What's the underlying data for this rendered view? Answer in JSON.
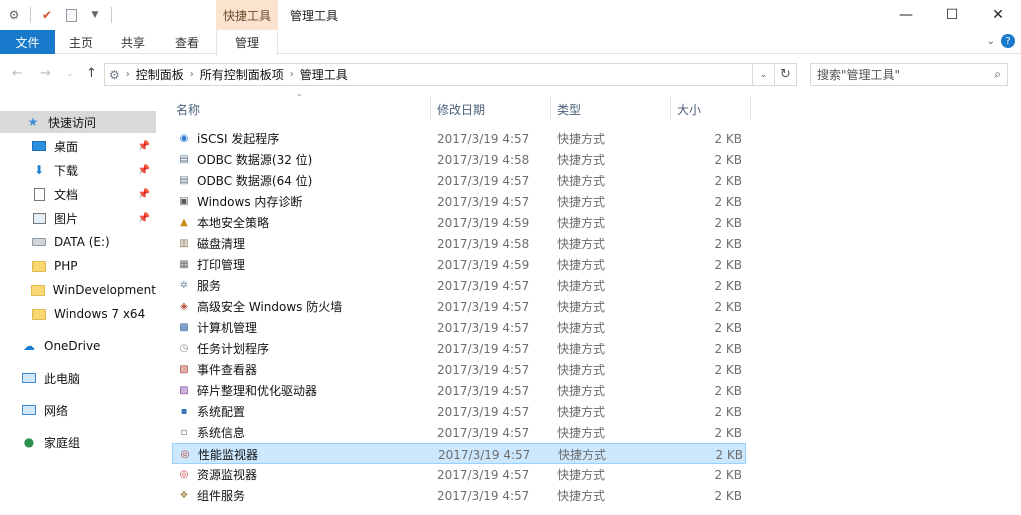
{
  "titlebar": {
    "context_tab_header": "快捷工具",
    "window_title": "管理工具",
    "minimize": "—",
    "maximize": "☐",
    "close": "✕"
  },
  "ribbon": {
    "tabs": {
      "file": "文件",
      "home": "主页",
      "share": "共享",
      "view": "查看",
      "manage": "管理"
    },
    "help": "?"
  },
  "address": {
    "crumbs": [
      "控制面板",
      "所有控制面板项",
      "管理工具"
    ],
    "search_placeholder": "搜索\"管理工具\""
  },
  "navpane": {
    "quick_access": "快速访问",
    "pinned": [
      {
        "label": "桌面",
        "icon": "desktop-icon"
      },
      {
        "label": "下载",
        "icon": "download-icon"
      },
      {
        "label": "文档",
        "icon": "document-icon"
      },
      {
        "label": "图片",
        "icon": "picture-icon"
      }
    ],
    "other": [
      {
        "label": "DATA (E:)",
        "icon": "drive-icon"
      },
      {
        "label": "PHP",
        "icon": "folder-icon"
      },
      {
        "label": "WinDevelopment",
        "icon": "folder-icon"
      },
      {
        "label": "Windows 7 x64",
        "icon": "folder-icon"
      }
    ],
    "onedrive": "OneDrive",
    "this_pc": "此电脑",
    "network": "网络",
    "homegroup": "家庭组"
  },
  "columns": {
    "name": "名称",
    "date": "修改日期",
    "type": "类型",
    "size": "大小"
  },
  "files": [
    {
      "name": "iSCSI 发起程序",
      "date": "2017/3/19 4:57",
      "type": "快捷方式",
      "size": "2 KB",
      "icon": "globe-icon",
      "color": "#2e7bcf"
    },
    {
      "name": "ODBC 数据源(32 位)",
      "date": "2017/3/19 4:58",
      "type": "快捷方式",
      "size": "2 KB",
      "icon": "database-icon",
      "color": "#5a6f84"
    },
    {
      "name": "ODBC 数据源(64 位)",
      "date": "2017/3/19 4:57",
      "type": "快捷方式",
      "size": "2 KB",
      "icon": "database-icon",
      "color": "#5a6f84"
    },
    {
      "name": "Windows 内存诊断",
      "date": "2017/3/19 4:57",
      "type": "快捷方式",
      "size": "2 KB",
      "icon": "memory-icon",
      "color": "#5b5b5b"
    },
    {
      "name": "本地安全策略",
      "date": "2017/3/19 4:59",
      "type": "快捷方式",
      "size": "2 KB",
      "icon": "security-icon",
      "color": "#c98a1a"
    },
    {
      "name": "磁盘清理",
      "date": "2017/3/19 4:58",
      "type": "快捷方式",
      "size": "2 KB",
      "icon": "disk-cleanup-icon",
      "color": "#8a7a5a"
    },
    {
      "name": "打印管理",
      "date": "2017/3/19 4:59",
      "type": "快捷方式",
      "size": "2 KB",
      "icon": "printer-icon",
      "color": "#6a6a6a"
    },
    {
      "name": "服务",
      "date": "2017/3/19 4:57",
      "type": "快捷方式",
      "size": "2 KB",
      "icon": "services-icon",
      "color": "#7a8fa5"
    },
    {
      "name": "高级安全 Windows 防火墙",
      "date": "2017/3/19 4:57",
      "type": "快捷方式",
      "size": "2 KB",
      "icon": "firewall-icon",
      "color": "#b5482e"
    },
    {
      "name": "计算机管理",
      "date": "2017/3/19 4:57",
      "type": "快捷方式",
      "size": "2 KB",
      "icon": "computer-management-icon",
      "color": "#3c6fa8"
    },
    {
      "name": "任务计划程序",
      "date": "2017/3/19 4:57",
      "type": "快捷方式",
      "size": "2 KB",
      "icon": "clock-icon",
      "color": "#8c8c8c"
    },
    {
      "name": "事件查看器",
      "date": "2017/3/19 4:57",
      "type": "快捷方式",
      "size": "2 KB",
      "icon": "event-viewer-icon",
      "color": "#b03a2e"
    },
    {
      "name": "碎片整理和优化驱动器",
      "date": "2017/3/19 4:57",
      "type": "快捷方式",
      "size": "2 KB",
      "icon": "defrag-icon",
      "color": "#7a3fa0"
    },
    {
      "name": "系统配置",
      "date": "2017/3/19 4:57",
      "type": "快捷方式",
      "size": "2 KB",
      "icon": "system-config-icon",
      "color": "#3c78b8"
    },
    {
      "name": "系统信息",
      "date": "2017/3/19 4:57",
      "type": "快捷方式",
      "size": "2 KB",
      "icon": "system-info-icon",
      "color": "#5c7088"
    },
    {
      "name": "性能监视器",
      "date": "2017/3/19 4:57",
      "type": "快捷方式",
      "size": "2 KB",
      "icon": "performance-monitor-icon",
      "color": "#c23b2e"
    },
    {
      "name": "资源监视器",
      "date": "2017/3/19 4:57",
      "type": "快捷方式",
      "size": "2 KB",
      "icon": "resource-monitor-icon",
      "color": "#c23b2e"
    },
    {
      "name": "组件服务",
      "date": "2017/3/19 4:57",
      "type": "快捷方式",
      "size": "2 KB",
      "icon": "component-services-icon",
      "color": "#a09050"
    }
  ],
  "selected_index": 15,
  "accent": "#1979ca"
}
